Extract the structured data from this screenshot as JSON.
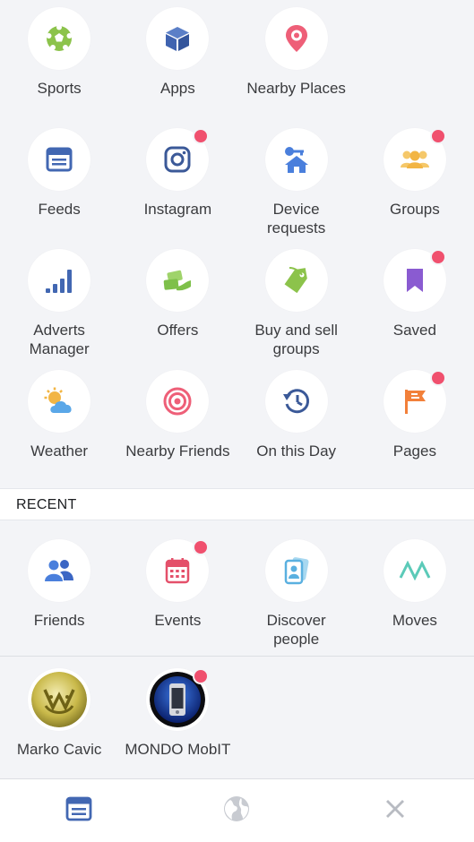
{
  "shortcuts": [
    {
      "label": "Sports",
      "icon": "sports-ball-icon",
      "badge": false
    },
    {
      "label": "Apps",
      "icon": "apps-cube-icon",
      "badge": false
    },
    {
      "label": "Nearby Places",
      "icon": "location-pin-icon",
      "badge": false
    },
    {
      "label": "Feeds",
      "icon": "feeds-icon",
      "badge": false
    },
    {
      "label": "Instagram",
      "icon": "instagram-icon",
      "badge": true
    },
    {
      "label": "Device\nrequests",
      "icon": "device-requests-icon",
      "badge": false
    },
    {
      "label": "Groups",
      "icon": "groups-icon",
      "badge": true
    },
    {
      "label": "Adverts\nManager",
      "icon": "adverts-chart-icon",
      "badge": false
    },
    {
      "label": "Offers",
      "icon": "offers-icon",
      "badge": false
    },
    {
      "label": "Buy and sell\ngroups",
      "icon": "price-tag-icon",
      "badge": false
    },
    {
      "label": "Saved",
      "icon": "bookmark-icon",
      "badge": true
    },
    {
      "label": "Weather",
      "icon": "weather-icon",
      "badge": false
    },
    {
      "label": "Nearby Friends",
      "icon": "target-icon",
      "badge": false
    },
    {
      "label": "On this Day",
      "icon": "history-clock-icon",
      "badge": false
    },
    {
      "label": "Pages",
      "icon": "flag-icon",
      "badge": true
    }
  ],
  "recent": {
    "header": "RECENT",
    "items": [
      {
        "label": "Friends",
        "icon": "friends-icon",
        "badge": false
      },
      {
        "label": "Events",
        "icon": "calendar-icon",
        "badge": true
      },
      {
        "label": "Discover\npeople",
        "icon": "discover-people-icon",
        "badge": false
      },
      {
        "label": "Moves",
        "icon": "moves-icon",
        "badge": false
      }
    ]
  },
  "people": [
    {
      "label": "Marko Cavic",
      "badge": false
    },
    {
      "label": "MONDO MobIT",
      "badge": true
    }
  ],
  "bottom_nav": [
    {
      "name": "feed-tab",
      "icon": "news-feed-icon"
    },
    {
      "name": "globe-tab",
      "icon": "globe-icon"
    },
    {
      "name": "close-tab",
      "icon": "close-icon"
    }
  ],
  "colors": {
    "background": "#f3f4f7",
    "badge": "#f0506e",
    "facebook_blue": "#4267b2"
  }
}
